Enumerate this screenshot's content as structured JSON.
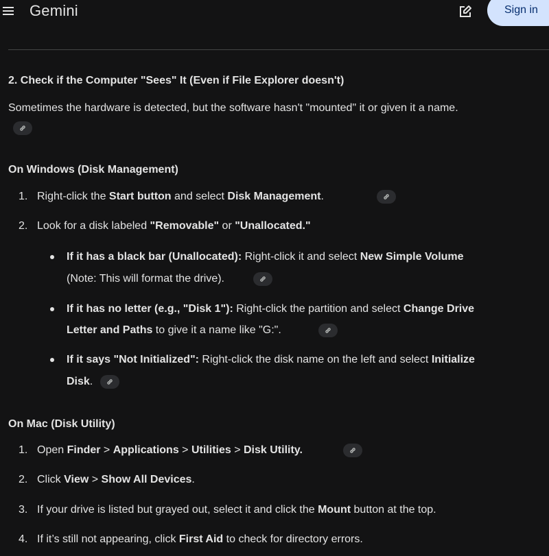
{
  "header": {
    "title": "Gemini",
    "signin_label": "Sign in",
    "icons": [
      "menu-icon",
      "edit-icon"
    ]
  },
  "content": {
    "section2_heading": "2. Check if the Computer \"Sees\" It (Even if File Explorer doesn't)",
    "section2_intro": "Sometimes the hardware is detected, but the software hasn't \"mounted\" it or given it a name.",
    "windows": {
      "heading": "On Windows (Disk Management)",
      "step1": {
        "num": "1.",
        "a": "Right-click the ",
        "b": "Start button",
        "c": " and select ",
        "d": "Disk Management",
        "e": "."
      },
      "step2": {
        "num": "2.",
        "a": "Look for a disk labeled ",
        "b": "\"Removable\"",
        "c": " or ",
        "d": "\"Unallocated.\""
      },
      "bullet1": {
        "a": "If it has a black bar (Unallocated):",
        "b": " Right-click it and select ",
        "c": "New Simple Volume",
        "line2": "(Note: This will format the drive)."
      },
      "bullet2": {
        "a": "If it has no letter (e.g., \"Disk 1\"):",
        "b": " Right-click the partition and select ",
        "c": "Change Drive",
        "d": "Letter and Paths",
        "e": " to give it a name like \"G:\"."
      },
      "bullet3": {
        "a": "If it says \"Not Initialized\":",
        "b": " Right-click the disk name on the left and select ",
        "c": "Initialize",
        "d": "Disk",
        "e": "."
      }
    },
    "mac": {
      "heading": "On Mac (Disk Utility)",
      "step1": {
        "num": "1.",
        "a": "Open ",
        "b": "Finder",
        "c": " > ",
        "d": "Applications",
        "e": " > ",
        "f": "Utilities",
        "g": " > ",
        "h": "Disk Utility."
      },
      "step2": {
        "num": "2.",
        "a": "Click ",
        "b": "View",
        "c": " > ",
        "d": "Show All Devices",
        "e": "."
      },
      "step3": {
        "num": "3.",
        "a": "If your drive is listed but grayed out, select it and click the ",
        "b": "Mount",
        "c": " button at the top."
      },
      "step4": {
        "num": "4.",
        "a": "If it’s still not appearing, click ",
        "b": "First Aid",
        "c": " to check for directory errors."
      }
    }
  },
  "colors": {
    "background": "#131314",
    "text": "#e3e3e3",
    "signin_bg": "#d3e3fd",
    "signin_text": "#062e6f",
    "chip_bg": "#2b2c2f"
  },
  "link_icon": "link-icon"
}
